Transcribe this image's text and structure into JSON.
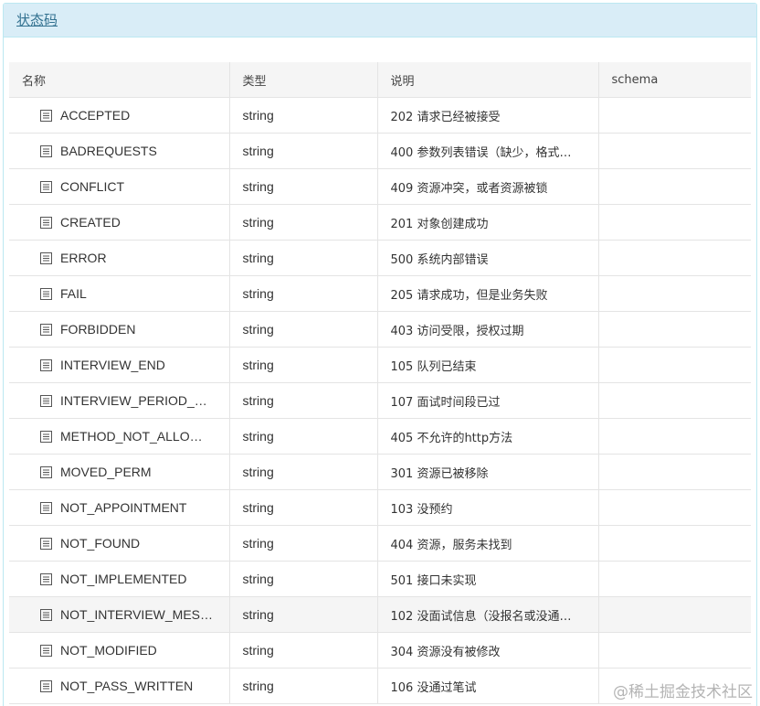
{
  "panel": {
    "title": "状态码"
  },
  "table": {
    "headers": [
      "名称",
      "类型",
      "说明",
      "schema"
    ],
    "rows": [
      {
        "name": "ACCEPTED",
        "type": "string",
        "desc": "202 请求已经被接受",
        "schema": ""
      },
      {
        "name": "BADREQUESTS",
        "type": "string",
        "desc": "400 参数列表错误（缺少，格式…",
        "schema": ""
      },
      {
        "name": "CONFLICT",
        "type": "string",
        "desc": "409 资源冲突，或者资源被锁",
        "schema": ""
      },
      {
        "name": "CREATED",
        "type": "string",
        "desc": "201 对象创建成功",
        "schema": ""
      },
      {
        "name": "ERROR",
        "type": "string",
        "desc": "500 系统内部错误",
        "schema": ""
      },
      {
        "name": "FAIL",
        "type": "string",
        "desc": "205 请求成功，但是业务失败",
        "schema": ""
      },
      {
        "name": "FORBIDDEN",
        "type": "string",
        "desc": "403 访问受限，授权过期",
        "schema": ""
      },
      {
        "name": "INTERVIEW_END",
        "type": "string",
        "desc": "105 队列已结束",
        "schema": ""
      },
      {
        "name": "INTERVIEW_PERIOD_…",
        "type": "string",
        "desc": "107 面试时间段已过",
        "schema": ""
      },
      {
        "name": "METHOD_NOT_ALLO…",
        "type": "string",
        "desc": "405 不允许的http方法",
        "schema": ""
      },
      {
        "name": "MOVED_PERM",
        "type": "string",
        "desc": "301 资源已被移除",
        "schema": ""
      },
      {
        "name": "NOT_APPOINTMENT",
        "type": "string",
        "desc": "103 没预约",
        "schema": ""
      },
      {
        "name": "NOT_FOUND",
        "type": "string",
        "desc": "404 资源，服务未找到",
        "schema": ""
      },
      {
        "name": "NOT_IMPLEMENTED",
        "type": "string",
        "desc": "501 接口未实现",
        "schema": ""
      },
      {
        "name": "NOT_INTERVIEW_MES…",
        "type": "string",
        "desc": "102 没面试信息（没报名或没通…",
        "schema": "",
        "highlighted": true
      },
      {
        "name": "NOT_MODIFIED",
        "type": "string",
        "desc": "304 资源没有被修改",
        "schema": ""
      },
      {
        "name": "NOT_PASS_WRITTEN",
        "type": "string",
        "desc": "106 没通过笔试",
        "schema": ""
      }
    ]
  },
  "watermark": "@稀土掘金技术社区",
  "icons": {
    "row_icon": "document-list-icon"
  },
  "colors": {
    "heading_bg": "#d9edf7",
    "heading_text": "#31708f",
    "border": "#bce8f1"
  }
}
